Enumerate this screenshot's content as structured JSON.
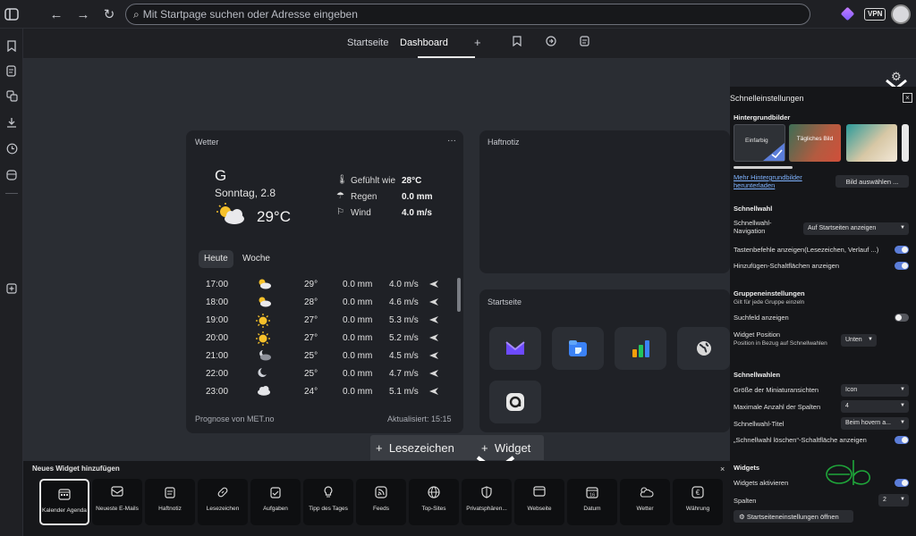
{
  "browser": {
    "url_placeholder": "Mit Startpage suchen oder Adresse eingeben",
    "vpn_label": "VPN"
  },
  "tabs": {
    "items": [
      "Startseite",
      "Dashboard"
    ],
    "add": "+"
  },
  "weather": {
    "title": "Wetter",
    "menu": "···",
    "location": "G",
    "date": "Sonntag, 2.8",
    "temp": "29°C",
    "feels_label": "Gefühlt wie",
    "feels_value": "28°C",
    "rain_label": "Regen",
    "rain_value": "0.0 mm",
    "wind_label": "Wind",
    "wind_value": "4.0 m/s",
    "tab_today": "Heute",
    "tab_week": "Woche",
    "hourly": [
      {
        "time": "17:00",
        "icon": "partly-cloudy-icon",
        "temp": "29°",
        "rain": "0.0 mm",
        "wind": "4.0 m/s"
      },
      {
        "time": "18:00",
        "icon": "partly-cloudy-icon",
        "temp": "28°",
        "rain": "0.0 mm",
        "wind": "4.6 m/s"
      },
      {
        "time": "19:00",
        "icon": "sun-icon",
        "temp": "27°",
        "rain": "0.0 mm",
        "wind": "5.3 m/s"
      },
      {
        "time": "20:00",
        "icon": "sun-icon",
        "temp": "27°",
        "rain": "0.0 mm",
        "wind": "5.2 m/s"
      },
      {
        "time": "21:00",
        "icon": "moon-cloud-icon",
        "temp": "25°",
        "rain": "0.0 mm",
        "wind": "4.5 m/s"
      },
      {
        "time": "22:00",
        "icon": "moon-icon",
        "temp": "25°",
        "rain": "0.0 mm",
        "wind": "4.7 m/s"
      },
      {
        "time": "23:00",
        "icon": "cloud-icon",
        "temp": "24°",
        "rain": "0.0 mm",
        "wind": "5.1 m/s"
      }
    ],
    "source": "Prognose von MET.no",
    "updated": "Aktualisiert: 15:15"
  },
  "note": {
    "title": "Haftnotiz"
  },
  "startpage": {
    "title": "Startseite"
  },
  "addbar": {
    "bookmarks": "Lesezeichen",
    "widget": "Widget"
  },
  "new_widget": {
    "title": "Neues Widget hinzufügen",
    "close": "×",
    "items": [
      {
        "label": "Kalender Agenda",
        "icon": "calendar-icon"
      },
      {
        "label": "Neueste E-Mails",
        "icon": "mail-icon"
      },
      {
        "label": "Haftnotiz",
        "icon": "note-icon"
      },
      {
        "label": "Lesezeichen",
        "icon": "link-icon"
      },
      {
        "label": "Aufgaben",
        "icon": "tasks-icon"
      },
      {
        "label": "Tipp des Tages",
        "icon": "bulb-icon"
      },
      {
        "label": "Feeds",
        "icon": "rss-icon"
      },
      {
        "label": "Top-Sites",
        "icon": "globe-icon"
      },
      {
        "label": "Privatsphären...",
        "icon": "shield-icon"
      },
      {
        "label": "Webseite",
        "icon": "browser-icon"
      },
      {
        "label": "Datum",
        "icon": "date-icon"
      },
      {
        "label": "Wetter",
        "icon": "weather-icon"
      },
      {
        "label": "Währung",
        "icon": "currency-icon"
      }
    ],
    "date_num": "16"
  },
  "quick_settings": {
    "title": "Schnelleinstellungen",
    "bg_heading": "Hintergrundbilder",
    "bg_solid": "Einfarbig",
    "bg_daily": "Tägliches Bild",
    "bg_more_link": "Mehr Hintergrundbilder herunterladen",
    "bg_choose": "Bild auswählen ...",
    "speed_heading": "Schnellwahl",
    "nav_label": "Schnellwahl-Navigation",
    "nav_value": "Auf Startseiten anzeigen",
    "shortcuts_label": "Tastenbefehle anzeigen(Lesezeichen, Verlauf ...)",
    "add_buttons_label": "Hinzufügen-Schaltflächen anzeigen",
    "group_heading": "Gruppeneinstellungen",
    "group_sub": "Gilt für jede Gruppe einzeln",
    "search_label": "Suchfeld anzeigen",
    "widget_pos_label": "Widget Position",
    "widget_pos_sub": "Position in Bezug auf Schnellwahlen",
    "widget_pos_value": "Unten",
    "speeddials_heading": "Schnellwahlen",
    "thumb_size_label": "Größe der Miniaturansichten",
    "thumb_size_value": "Icon",
    "max_cols_label": "Maximale Anzahl der Spalten",
    "max_cols_value": "4",
    "dial_title_label": "Schnellwahl-Titel",
    "dial_title_value": "Beim hovern a...",
    "delete_btn_label": "„Schnellwahl löschen“-Schaltfläche anzeigen",
    "widgets_heading": "Widgets",
    "widgets_enable_label": "Widgets aktivieren",
    "columns_label": "Spalten",
    "columns_value": "2",
    "open_settings": "Startseiteneinstellungen öffnen",
    "close": "×"
  },
  "colors": {
    "accent": "#5b7dd8",
    "link": "#7fb3ff",
    "panel": "#151619",
    "widget_bg": "#1f2126"
  }
}
